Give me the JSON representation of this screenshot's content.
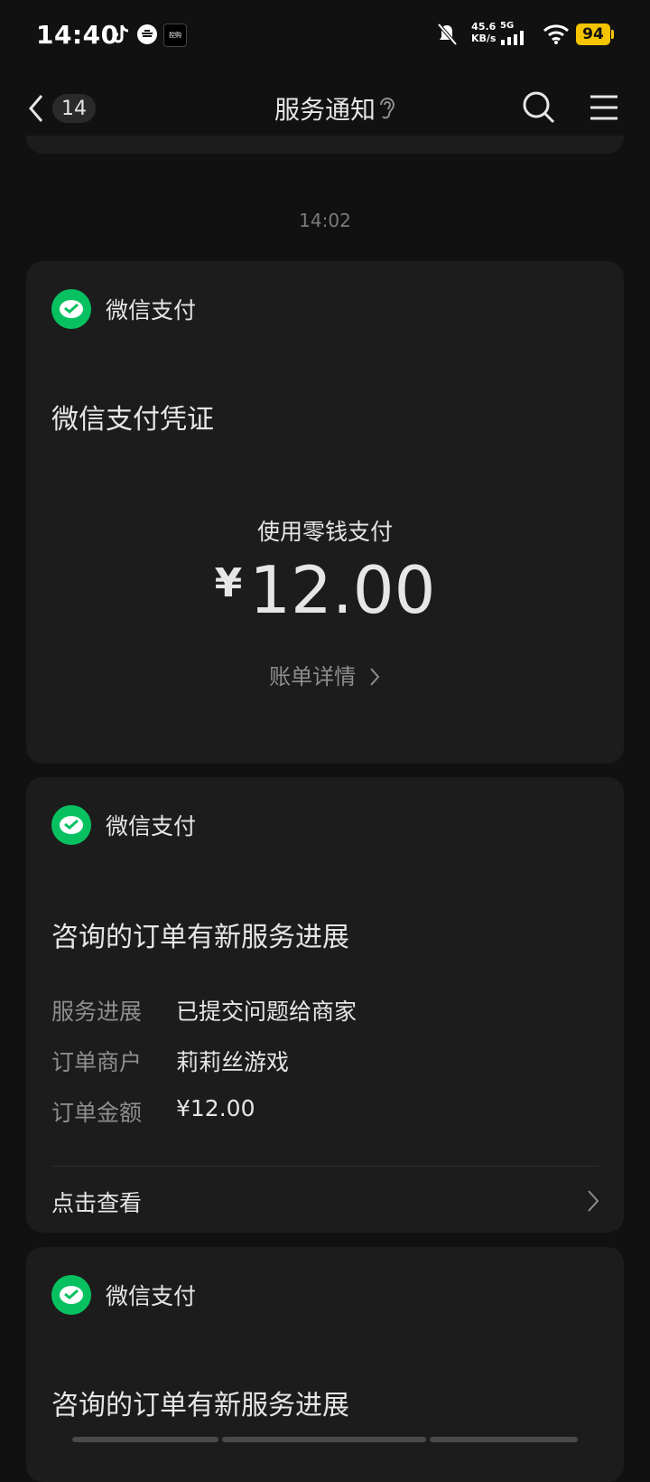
{
  "status_bar": {
    "time": "14:40",
    "net_speed": "45.6",
    "net_speed_unit": "KB/s",
    "network": "5G",
    "battery": "94",
    "app_icon_label": "控购"
  },
  "nav": {
    "unread_count": "14",
    "title": "服务通知"
  },
  "timestamp": "14:02",
  "cards": [
    {
      "source": "微信支付",
      "title": "微信支付凭证",
      "pay_method": "使用零钱支付",
      "currency": "¥",
      "amount": "12.00",
      "detail_link": "账单详情"
    },
    {
      "source": "微信支付",
      "title": "咨询的订单有新服务进展",
      "rows": [
        {
          "label": "服务进展",
          "value": "已提交问题给商家"
        },
        {
          "label": "订单商户",
          "value": "莉莉丝游戏"
        },
        {
          "label": "订单金额",
          "value": "¥12.00"
        }
      ],
      "action": "点击查看"
    },
    {
      "source": "微信支付",
      "title": "咨询的订单有新服务进展"
    }
  ],
  "colors": {
    "background": "#111111",
    "card": "#1c1c1c",
    "wechat_green": "#07c160",
    "battery": "#f5c400"
  }
}
